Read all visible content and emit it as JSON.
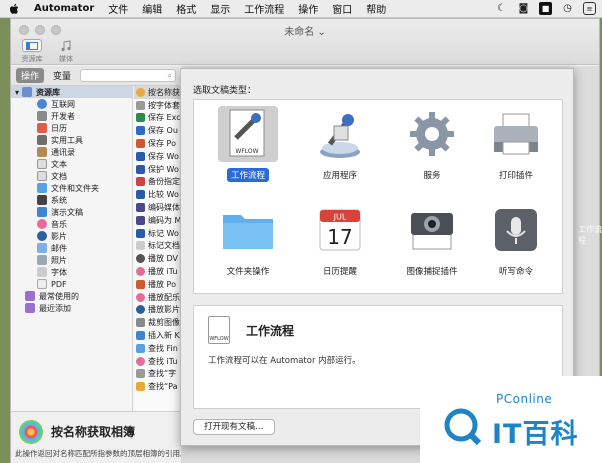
{
  "menubar": {
    "app_name": "Automator",
    "items": [
      "文件",
      "编辑",
      "格式",
      "显示",
      "工作流程",
      "操作",
      "窗口",
      "帮助"
    ]
  },
  "window": {
    "title": "未命名",
    "toolbar": {
      "library_label": "资源库",
      "media_label": "媒体"
    },
    "filter": {
      "actions_tab": "操作",
      "variables_tab": "变量"
    }
  },
  "library": {
    "header": "资源库",
    "items": [
      "互联网",
      "开发者",
      "日历",
      "实用工具",
      "通讯录",
      "文本",
      "文档",
      "文件和文件夹",
      "系统",
      "演示文稿",
      "音乐",
      "影片",
      "邮件",
      "照片",
      "字体",
      "PDF"
    ],
    "extra": [
      "最常使用的",
      "最近添加"
    ]
  },
  "actions": {
    "items": [
      "按名称获",
      "按字体套",
      "保存 Exc",
      "保存 Ou",
      "保存 Po",
      "保存 Wo",
      "保护 Wo",
      "备份指定",
      "比较 Wo",
      "编码媒体",
      "编码为 M",
      "标记 Wo",
      "标记文档",
      "播放 DV",
      "播放 iTu",
      "播放 Po",
      "播放配乐",
      "播放影片",
      "裁剪图像",
      "插入新 K",
      "查找 Fin",
      "查找 iTu",
      "查找“字",
      "查找“Pa"
    ]
  },
  "info": {
    "title": "按名称获取相簿",
    "description": "此操作返回对名称匹配所指参数的顶层相簿的引用。"
  },
  "sheet": {
    "prompt": "选取文稿类型：",
    "types": [
      {
        "label": "工作流程",
        "icon": "workflow-icon",
        "selected": true
      },
      {
        "label": "应用程序",
        "icon": "application-icon",
        "selected": false
      },
      {
        "label": "服务",
        "icon": "gear-icon",
        "selected": false
      },
      {
        "label": "打印插件",
        "icon": "printer-icon",
        "selected": false
      },
      {
        "label": "文件夹操作",
        "icon": "folder-icon",
        "selected": false
      },
      {
        "label": "日历提醒",
        "icon": "calendar-icon",
        "selected": false
      },
      {
        "label": "图像捕捉插件",
        "icon": "camera-icon",
        "selected": false
      },
      {
        "label": "听写命令",
        "icon": "microphone-icon",
        "selected": false
      }
    ],
    "calendar_month": "JUL",
    "calendar_day": "17",
    "workflow_badge": "WFLOW",
    "detail": {
      "title": "工作流程",
      "text": "工作流程可以在 Automator 内部运行。"
    },
    "open_button": "打开现有文稿…"
  },
  "behind_label": "工作流程",
  "watermark": {
    "brand_en": "PConline",
    "brand_cn": "IT百科"
  }
}
